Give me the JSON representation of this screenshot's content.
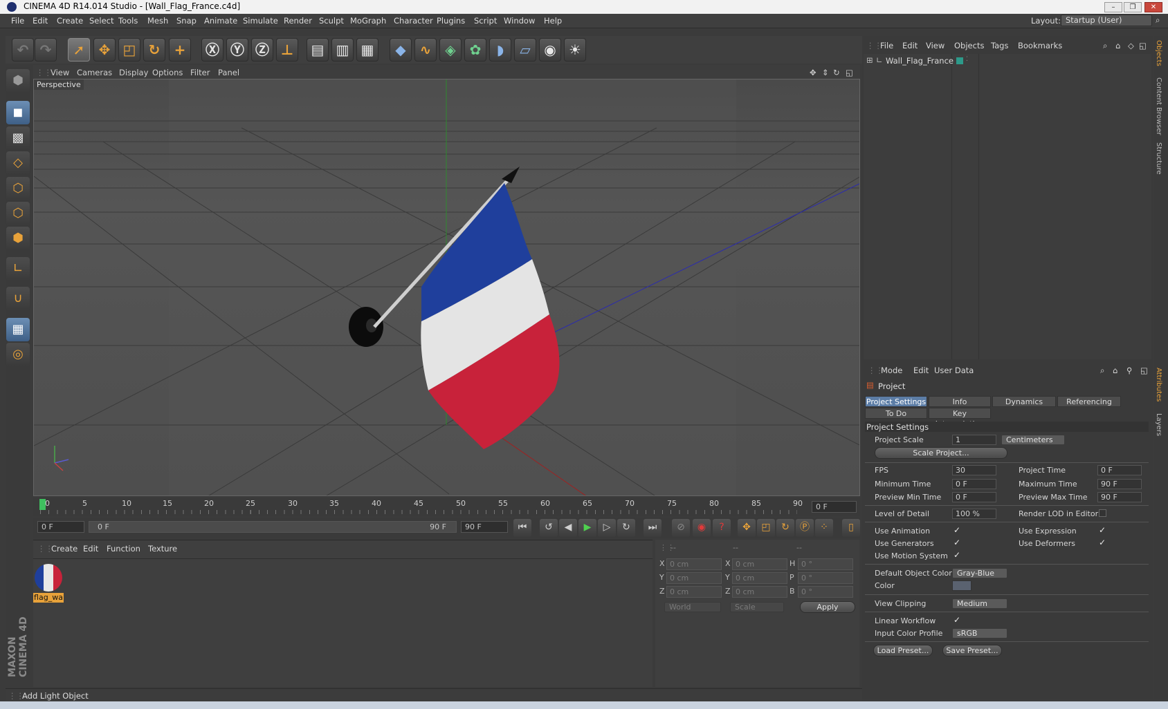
{
  "window": {
    "title": "CINEMA 4D R14.014 Studio - [Wall_Flag_France.c4d]",
    "minimize": "–",
    "maximize": "❐",
    "close": "✕"
  },
  "menu": [
    "File",
    "Edit",
    "Create",
    "Select",
    "Tools",
    "Mesh",
    "Snap",
    "Animate",
    "Simulate",
    "Render",
    "Sculpt",
    "MoGraph",
    "Character",
    "Plugins",
    "Script",
    "Window",
    "Help"
  ],
  "layout": {
    "label": "Layout:",
    "value": "Startup (User)"
  },
  "viewport": {
    "menu": [
      "View",
      "Cameras",
      "Display",
      "Options",
      "Filter",
      "Panel"
    ],
    "label": "Perspective"
  },
  "timeline": {
    "ticks": [
      "0",
      "5",
      "10",
      "15",
      "20",
      "25",
      "30",
      "35",
      "40",
      "45",
      "50",
      "55",
      "60",
      "65",
      "70",
      "75",
      "80",
      "85",
      "90"
    ],
    "current": "0 F",
    "start": "0 F",
    "range_start": "0 F",
    "range_end": "90 F",
    "end": "90 F"
  },
  "materials": {
    "menu": [
      "Create",
      "Edit",
      "Function",
      "Texture"
    ],
    "items": [
      {
        "name": "flag_wa"
      }
    ]
  },
  "coords": {
    "headers": [
      "--",
      "--",
      "--"
    ],
    "rows": [
      {
        "a": "X",
        "av": "0 cm",
        "b": "X",
        "bv": "0 cm",
        "c": "H",
        "cv": "0 °"
      },
      {
        "a": "Y",
        "av": "0 cm",
        "b": "Y",
        "bv": "0 cm",
        "c": "P",
        "cv": "0 °"
      },
      {
        "a": "Z",
        "av": "0 cm",
        "b": "Z",
        "bv": "0 cm",
        "c": "B",
        "cv": "0 °"
      }
    ],
    "space": "World",
    "mode": "Scale",
    "apply": "Apply"
  },
  "objects": {
    "menu": [
      "File",
      "Edit",
      "View",
      "Objects",
      "Tags",
      "Bookmarks"
    ],
    "items": [
      {
        "name": "Wall_Flag_France"
      }
    ]
  },
  "attributes": {
    "menu": [
      "Mode",
      "Edit",
      "User Data"
    ],
    "object": "Project",
    "tabs": [
      "Project Settings",
      "Info",
      "Dynamics",
      "Referencing"
    ],
    "tabs2": [
      "To Do",
      "Key Interpolation"
    ],
    "section": "Project Settings",
    "project_scale": {
      "label": "Project Scale",
      "value": "1",
      "unit": "Centimeters"
    },
    "scale_button": "Scale Project...",
    "fps": {
      "label": "FPS",
      "value": "30"
    },
    "project_time": {
      "label": "Project Time",
      "value": "0 F"
    },
    "min_time": {
      "label": "Minimum Time",
      "value": "0 F"
    },
    "max_time": {
      "label": "Maximum Time",
      "value": "90 F"
    },
    "prev_min": {
      "label": "Preview Min Time",
      "value": "0 F"
    },
    "prev_max": {
      "label": "Preview Max Time",
      "value": "90 F"
    },
    "lod": {
      "label": "Level of Detail",
      "value": "100 %"
    },
    "render_lod": "Render LOD in Editor",
    "use_animation": "Use Animation",
    "use_expression": "Use Expression",
    "use_generators": "Use Generators",
    "use_deformers": "Use Deformers",
    "use_motion": "Use Motion System",
    "default_color": {
      "label": "Default Object Color",
      "value": "Gray-Blue"
    },
    "color": {
      "label": "Color"
    },
    "view_clipping": {
      "label": "View Clipping",
      "value": "Medium"
    },
    "linear_workflow": "Linear Workflow",
    "input_profile": {
      "label": "Input Color Profile",
      "value": "sRGB"
    },
    "load_preset": "Load Preset...",
    "save_preset": "Save Preset..."
  },
  "sidetabs": [
    "Objects",
    "Content Browser",
    "Structure",
    "Attributes",
    "Layers"
  ],
  "status": "Add Light Object",
  "brand": "MAXON CINEMA 4D",
  "colors": {
    "accent": "#5c7da6",
    "flag_blue": "#1f3f9c",
    "flag_white": "#e8e8e8",
    "flag_red": "#c8223a"
  }
}
